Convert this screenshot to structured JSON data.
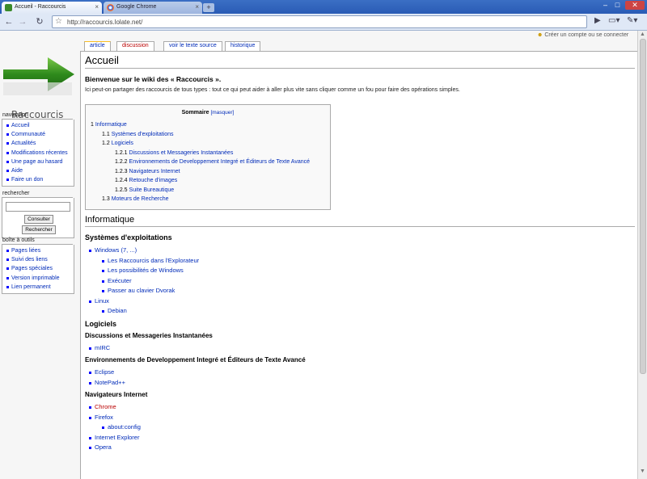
{
  "browser": {
    "tabs": [
      {
        "title": "Accueil - Raccourcis",
        "active": true
      },
      {
        "title": "Google Chrome",
        "active": false
      }
    ],
    "url": "http://raccourcis.lolate.net/",
    "window_controls": [
      "–",
      "□",
      "✕"
    ]
  },
  "personal": {
    "label": "Créer un compte ou se connecter"
  },
  "logo": {
    "text": "Raccourcis"
  },
  "page_tabs": [
    "article",
    "discussion",
    "voir le texte source",
    "historique"
  ],
  "sidebar": {
    "navigation": {
      "title": "navigation",
      "items": [
        "Accueil",
        "Communauté",
        "Actualités",
        "Modifications récentes",
        "Une page au hasard",
        "Aide",
        "Faire un don"
      ]
    },
    "search": {
      "title": "rechercher",
      "button_go": "Consulter",
      "button_search": "Rechercher"
    },
    "toolbox": {
      "title": "boîte à outils",
      "items": [
        "Pages liées",
        "Suivi des liens",
        "Pages spéciales",
        "Version imprimable",
        "Lien permanent"
      ]
    }
  },
  "content": {
    "heading": "Accueil",
    "welcome": "Bienvenue sur le wiki des « Raccourcis ».",
    "intro": "Ici peut-on partager des raccourcis de tous types : tout ce qui peut aider à aller plus vite sans cliquer comme un fou pour faire des opérations simples.",
    "toc": {
      "title": "Sommaire",
      "toggle": "[masquer]",
      "entries": [
        {
          "num": "1",
          "text": "Informatique",
          "level": 0
        },
        {
          "num": "1.1",
          "text": "Systèmes d'exploitations",
          "level": 1
        },
        {
          "num": "1.2",
          "text": "Logiciels",
          "level": 1
        },
        {
          "num": "1.2.1",
          "text": "Discussions et Messageries Instantanées",
          "level": 2
        },
        {
          "num": "1.2.2",
          "text": "Environnements de Developpement Integré et Éditeurs de Texte Avancé",
          "level": 2
        },
        {
          "num": "1.2.3",
          "text": "Navigateurs Internet",
          "level": 2
        },
        {
          "num": "1.2.4",
          "text": "Retouche d'images",
          "level": 2
        },
        {
          "num": "1.2.5",
          "text": "Suite Bureautique",
          "level": 2
        },
        {
          "num": "1.3",
          "text": "Moteurs de Recherche",
          "level": 1
        }
      ]
    },
    "section_informatique": "Informatique",
    "section_systemes": "Systèmes d'exploitations",
    "systemes_list": {
      "windows": "Windows (7, ...)",
      "windows_sub": [
        "Les Raccourcis dans l'Explorateur",
        "Les possibilités de Windows",
        "Exécuter",
        "Passer au clavier Dvorak"
      ],
      "linux": "Linux",
      "linux_sub": [
        "Debian"
      ]
    },
    "section_logiciels": "Logiciels",
    "section_discussions": "Discussions et Messageries Instantanées",
    "discussions_list": [
      "mIRC"
    ],
    "section_environnements": "Environnements de Developpement Integré et Éditeurs de Texte Avancé",
    "environnements_list": [
      "Eclipse",
      "NotePad++"
    ],
    "section_navigateurs": "Navigateurs Internet",
    "navigateurs_list": {
      "chrome": "Chrome",
      "firefox": "Firefox",
      "firefox_sub": [
        "about:config"
      ],
      "ie": "Internet Explorer",
      "opera": "Opera"
    }
  }
}
